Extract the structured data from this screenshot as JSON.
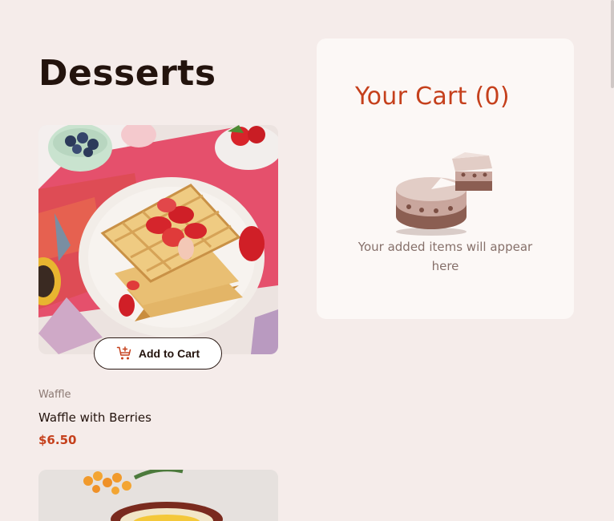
{
  "page": {
    "title": "Desserts"
  },
  "products": [
    {
      "category": "Waffle",
      "name": "Waffle with Berries",
      "price": "$6.50",
      "button_label": "Add to Cart"
    }
  ],
  "cart": {
    "title": "Your Cart (0)",
    "empty_line1": "Your added items will appear",
    "empty_line2": "here"
  },
  "colors": {
    "background": "#f5ecea",
    "accent": "#c5401c",
    "panel": "#fcf8f6",
    "text": "#23130d"
  },
  "icons": [
    "add-to-cart-icon",
    "cake-illustration"
  ]
}
